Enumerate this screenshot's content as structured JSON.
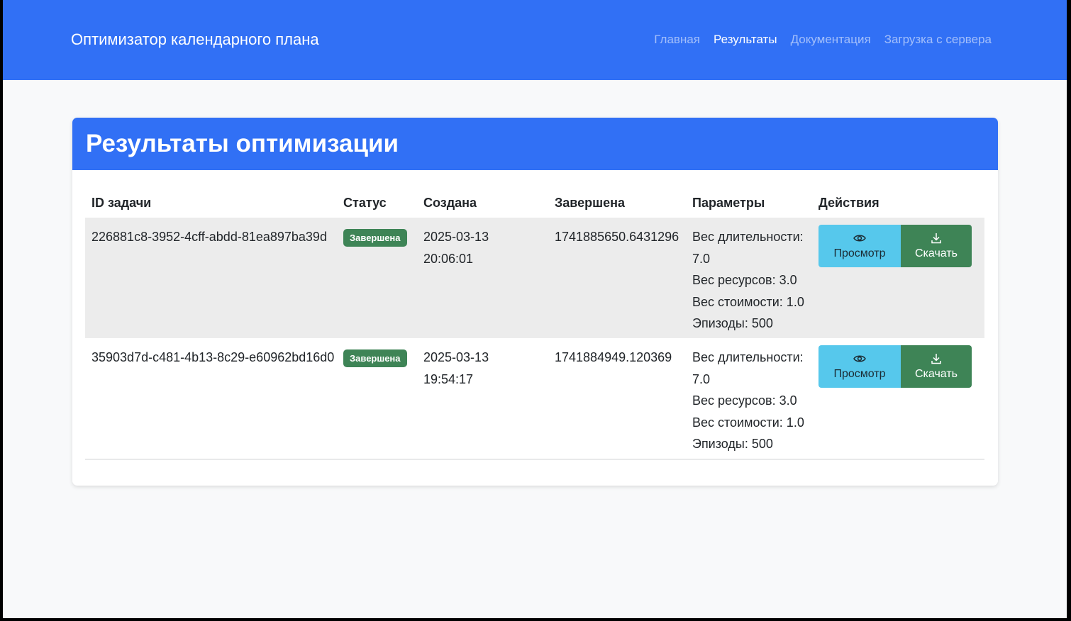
{
  "navbar": {
    "brand": "Оптимизатор календарного плана",
    "links": [
      "Главная",
      "Результаты",
      "Документация",
      "Загрузка с сервера"
    ],
    "active": "Результаты"
  },
  "card": {
    "title": "Результаты оптимизации"
  },
  "table": {
    "headers": [
      "ID задачи",
      "Статус",
      "Создана",
      "Завершена",
      "Параметры",
      "Действия"
    ],
    "rows": [
      {
        "id": "226881c8-3952-4cff-abdd-81ea897ba39d",
        "status": "Завершена",
        "created_date": "2025-03-13",
        "created_time": "20:06:01",
        "finished": "1741885650.6431296",
        "params": [
          "Вес длительности: 7.0",
          "Вес ресурсов: 3.0",
          "Вес стоимости: 1.0",
          "Эпизоды: 500"
        ],
        "view_label": "Просмотр",
        "download_label": "Скачать"
      },
      {
        "id": "35903d7d-c481-4b13-8c29-e60962bd16d0",
        "status": "Завершена",
        "created_date": "2025-03-13",
        "created_time": "19:54:17",
        "finished": "1741884949.120369",
        "params": [
          "Вес длительности: 7.0",
          "Вес ресурсов: 3.0",
          "Вес стоимости: 1.0",
          "Эпизоды: 500"
        ],
        "view_label": "Просмотр",
        "download_label": "Скачать"
      }
    ]
  },
  "icons": {
    "view": "eye-icon",
    "download": "download-icon"
  },
  "colors": {
    "primary": "#3170f5",
    "success": "#3e8456",
    "info": "#56c8ec",
    "background": "#f8f9fa",
    "striped_row": "#ececec"
  }
}
